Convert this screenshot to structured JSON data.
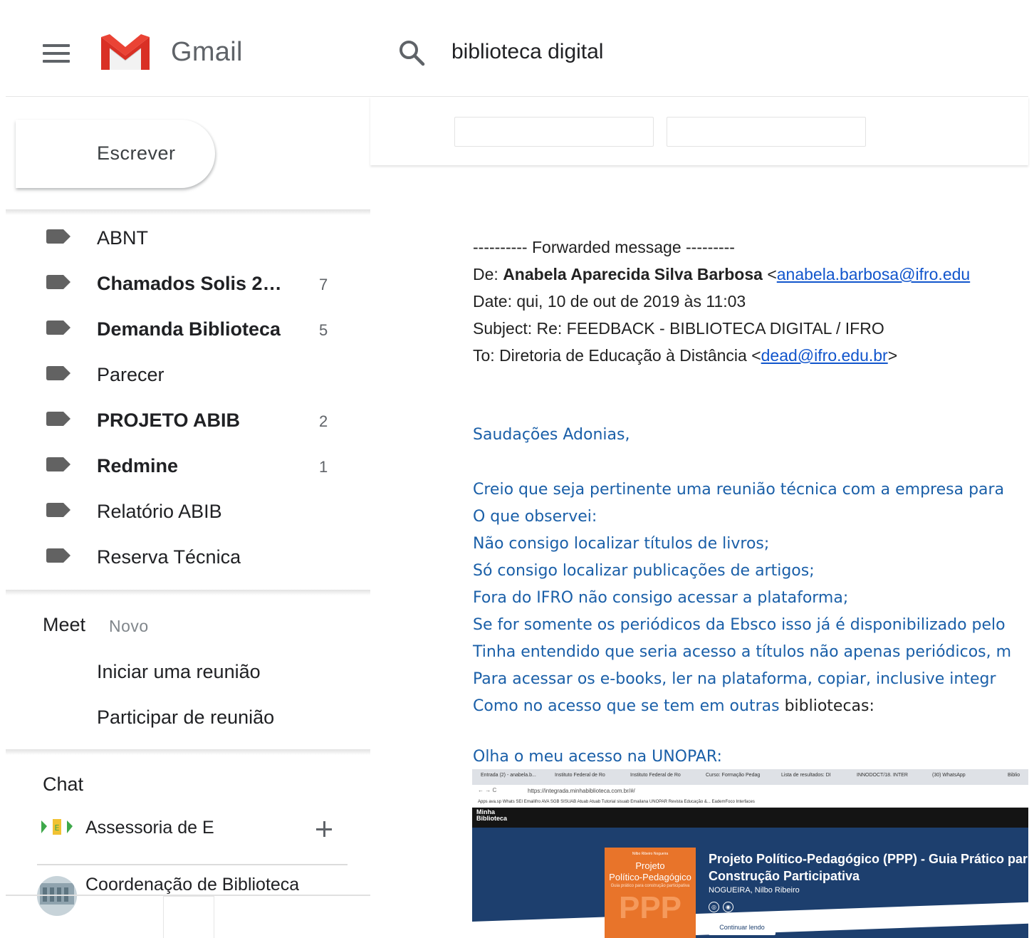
{
  "header": {
    "app_name": "Gmail",
    "search_value": "biblioteca digital"
  },
  "sidebar": {
    "compose_label": "Escrever",
    "labels": [
      {
        "name": "ABNT",
        "count": "",
        "bold": false
      },
      {
        "name": "Chamados Solis 20…",
        "count": "7",
        "bold": true
      },
      {
        "name": "Demanda Biblioteca",
        "count": "5",
        "bold": true
      },
      {
        "name": "Parecer",
        "count": "",
        "bold": false
      },
      {
        "name": "PROJETO ABIB",
        "count": "2",
        "bold": true
      },
      {
        "name": "Redmine",
        "count": "1",
        "bold": true
      },
      {
        "name": "Relatório ABIB",
        "count": "",
        "bold": false
      },
      {
        "name": "Reserva Técnica",
        "count": "",
        "bold": false
      }
    ],
    "meet": {
      "title": "Meet",
      "badge": "Novo",
      "start_meeting": "Iniciar uma reunião",
      "join_meeting": "Participar de reunião"
    },
    "chat": {
      "title": "Chat",
      "contacts": [
        {
          "name": "Assessoria de E"
        },
        {
          "name": "Coordenação de Biblioteca"
        }
      ]
    }
  },
  "message": {
    "forward_line": "---------- Forwarded message ---------",
    "from_label": "De:",
    "from_name": "Anabela Aparecida Silva Barbosa",
    "from_email": "anabela.barbosa@ifro.edu",
    "date_line": "Date: qui, 10 de out de 2019 às 11:03",
    "subject_line": "Subject: Re: FEEDBACK - BIBLIOTECA DIGITAL / IFRO",
    "to_prefix": "To: Diretoria de Educação à Distância <",
    "to_email": "dead@ifro.edu.br",
    "to_suffix": ">",
    "lt": "<",
    "gt": ">",
    "greeting": "Saudações Adonias,",
    "body_lines": [
      "Creio que seja pertinente uma reunião técnica com a empresa para",
      "O que observei:",
      "Não consigo localizar títulos de livros;",
      "Só consigo localizar publicações de artigos;",
      "Fora do IFRO não consigo acessar a plataforma;",
      "Se for somente os periódicos da Ebsco isso já é disponibilizado pelo",
      "Tinha entendido que seria acesso a títulos não apenas periódicos, m",
      "Para acessar os e-books, ler na plataforma, copiar, inclusive integr"
    ],
    "last_line_blue": "Como no acesso que se tem em outras ",
    "last_line_dark": "bibliotecas:",
    "unopar_line": "Olha o meu acesso na UNOPAR:"
  },
  "embed": {
    "tabs": [
      "Entrada (2) - anabela.b...",
      "Instituto Federal de Ro",
      "Instituto Federal de Ro",
      "Curso: Formação Pedag",
      "Lista de resultados: DI",
      "INNODOCT/18. INTER",
      "(30) WhatsApp",
      "Biblio"
    ],
    "url": "https://integrada.minhabiblioteca.com.br/#/",
    "bookmarks": "Apps   ava.sp   Whats   SEI   Emailifro   AVA   SGB   SISUAB   Atuab   Atuab   Tutorial sisuab   Emailana   UNOPAR   Revista Educação &...   EademFoco   Interfaces",
    "brand_line1": "Minha",
    "brand_line2": "Biblioteca",
    "book_author_small": "Nilbo Ribeiro Nogueira",
    "book_title_1": "Projeto",
    "book_title_2": "Político-Pedagógico",
    "book_subtitle": "Guia prático para construção participativa",
    "book_big": "PPP",
    "title_line1": "Projeto Político-Pedagógico (PPP) - Guia Prático par",
    "title_line2": "Construção Participativa",
    "author": "NOGUEIRA, Nilbo Ribeiro",
    "button": "Continuar lendo"
  },
  "colors": {
    "link": "#1155cc",
    "body_blue": "#1a5fa8",
    "hero": "#1d3f6e",
    "book": "#e8742a",
    "gmail_red": "#d93025"
  }
}
